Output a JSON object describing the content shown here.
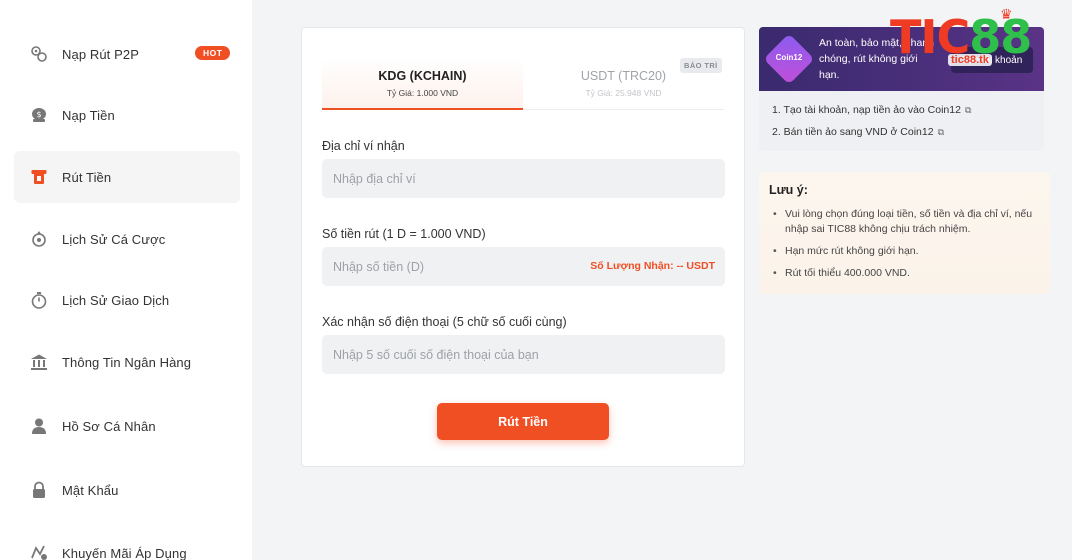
{
  "sidebar": {
    "items": [
      {
        "label": "Nạp Rút P2P",
        "icon": "p2p-exchange-icon",
        "badge": "HOT"
      },
      {
        "label": "Nạp Tiền",
        "icon": "deposit-coin-icon"
      },
      {
        "label": "Rút Tiền",
        "icon": "withdraw-icon"
      },
      {
        "label": "Lịch Sử Cá Cược",
        "icon": "bet-history-icon"
      },
      {
        "label": "Lịch Sử Giao Dịch",
        "icon": "stopwatch-icon"
      },
      {
        "label": "Thông Tin Ngân Hàng",
        "icon": "bank-icon"
      },
      {
        "label": "Hồ Sơ Cá Nhân",
        "icon": "user-icon"
      },
      {
        "label": "Mật Khẩu",
        "icon": "lock-icon"
      },
      {
        "label": "Khuyến Mãi Áp Dụng",
        "icon": "promotion-icon"
      }
    ],
    "active_index": 2
  },
  "withdraw_form": {
    "tabs": [
      {
        "title": "KDG (KCHAIN)",
        "rate": "Tỷ Giá: 1.000 VND",
        "active": true
      },
      {
        "title": "USDT (TRC20)",
        "rate": "Tỷ Giá: 25.948 VND",
        "active": false,
        "badge": "BẢO TRÌ"
      }
    ],
    "wallet_label": "Địa chỉ ví nhận",
    "wallet_placeholder": "Nhập địa chỉ ví",
    "amount_label": "Số tiền rút (1 D = 1.000 VND)",
    "amount_placeholder": "Nhập số tiền (D)",
    "receive_text": "Số Lượng Nhận: -- USDT",
    "phone_label": "Xác nhận số điện thoại (5 chữ số cuối cùng)",
    "phone_placeholder": "Nhập 5 số cuối số điện thoại của bạn",
    "submit_label": "Rút Tiền"
  },
  "promo": {
    "logo_text": "Coin12",
    "banner_text": "An toàn, bảo mật, nhanh chóng, rút không giới hạn.",
    "button_label": "Tạo tài khoản",
    "steps": [
      "1. Tạo tài khoản, nạp tiền ảo vào Coin12",
      "2. Bán tiền ảo sang VND ở Coin12"
    ]
  },
  "note": {
    "title": "Lưu ý:",
    "items": [
      "Vui lòng chọn đúng loại tiền, số tiền và địa chỉ ví, nếu nhập sai TIC88 không chịu trách nhiệm.",
      "Hạn mức rút không giới hạn.",
      "Rút tối thiểu 400.000 VND."
    ]
  },
  "brand": {
    "logo_part1": "TIC",
    "logo_part2": "88",
    "sub": "tic88.tk"
  },
  "colors": {
    "accent": "#f04e23",
    "brand_green": "#2ec04a",
    "promo_purple": "#3a2a6e"
  }
}
